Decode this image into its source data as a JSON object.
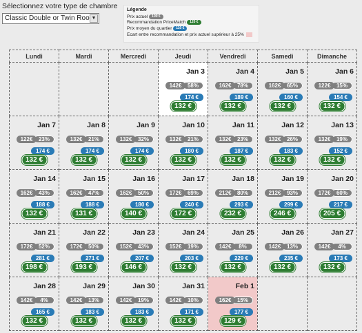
{
  "room": {
    "label": "Sélectionnez votre type de chambre",
    "selected": "Classic Double or Twin Room"
  },
  "legend": {
    "title": "Légende",
    "current_price_label": "Prix actuel",
    "current_price_sample": "100 €",
    "recommendation_label": "Recommandation PriceMatch",
    "recommendation_sample": "120 €",
    "avg_label": "Prix moyen du quartier",
    "avg_sample": "110 €",
    "gap_label": "Ecart entre recommandation et prix actuel supérieur à 25%"
  },
  "colors": {
    "current": "#808080",
    "average": "#2a7bb6",
    "recommendation": "#2e7d32",
    "alert": "#f2c9c9",
    "today": "#ffffff"
  },
  "calendar": {
    "weekdays": [
      "Lundi",
      "Mardi",
      "Mercredi",
      "Jeudi",
      "Vendredi",
      "Samedi",
      "Dimanche"
    ],
    "weeks": [
      [
        null,
        null,
        null,
        {
          "date": "Jan 3",
          "price": "142€",
          "pct": "58%",
          "avg": "174 €",
          "rec": "132 €",
          "today": true
        },
        {
          "date": "Jan 4",
          "price": "162€",
          "pct": "78%",
          "avg": "189 €",
          "rec": "132 €"
        },
        {
          "date": "Jan 5",
          "price": "162€",
          "pct": "65%",
          "avg": "160 €",
          "rec": "132 €"
        },
        {
          "date": "Jan 6",
          "price": "122€",
          "pct": "15%",
          "avg": "154 €",
          "rec": "132 €"
        }
      ],
      [
        {
          "date": "Jan 7",
          "price": "122€",
          "pct": "23%",
          "avg": "174 €",
          "rec": "132 €"
        },
        {
          "date": "Jan 8",
          "price": "132€",
          "pct": "21%",
          "avg": "174 €",
          "rec": "132 €"
        },
        {
          "date": "Jan 9",
          "price": "132€",
          "pct": "32%",
          "avg": "174 €",
          "rec": "132 €"
        },
        {
          "date": "Jan 10",
          "price": "132€",
          "pct": "21%",
          "avg": "180 €",
          "rec": "132 €"
        },
        {
          "date": "Jan 11",
          "price": "132€",
          "pct": "23%",
          "avg": "187 €",
          "rec": "132 €"
        },
        {
          "date": "Jan 12",
          "price": "132€",
          "pct": "26%",
          "avg": "183 €",
          "rec": "132 €"
        },
        {
          "date": "Jan 13",
          "price": "132€",
          "pct": "19%",
          "avg": "152 €",
          "rec": "132 €"
        }
      ],
      [
        {
          "date": "Jan 14",
          "price": "162€",
          "pct": "43%",
          "avg": "188 €",
          "rec": "132 €"
        },
        {
          "date": "Jan 15",
          "price": "162€",
          "pct": "47%",
          "avg": "188 €",
          "rec": "131 €"
        },
        {
          "date": "Jan 16",
          "price": "162€",
          "pct": "50%",
          "avg": "180 €",
          "rec": "140 €"
        },
        {
          "date": "Jan 17",
          "price": "172€",
          "pct": "69%",
          "avg": "240 €",
          "rec": "172 €"
        },
        {
          "date": "Jan 18",
          "price": "212€",
          "pct": "80%",
          "avg": "293 €",
          "rec": "232 €"
        },
        {
          "date": "Jan 19",
          "price": "212€",
          "pct": "93%",
          "avg": "299 €",
          "rec": "246 €"
        },
        {
          "date": "Jan 20",
          "price": "172€",
          "pct": "60%",
          "avg": "217 €",
          "rec": "205 €"
        }
      ],
      [
        {
          "date": "Jan 21",
          "price": "172€",
          "pct": "52%",
          "avg": "281 €",
          "rec": "198 €"
        },
        {
          "date": "Jan 22",
          "price": "172€",
          "pct": "50%",
          "avg": "271 €",
          "rec": "193 €"
        },
        {
          "date": "Jan 23",
          "price": "152€",
          "pct": "43%",
          "avg": "207 €",
          "rec": "146 €"
        },
        {
          "date": "Jan 24",
          "price": "152€",
          "pct": "19%",
          "avg": "203 €",
          "rec": "132 €"
        },
        {
          "date": "Jan 25",
          "price": "142€",
          "pct": "8%",
          "avg": "229 €",
          "rec": "132 €"
        },
        {
          "date": "Jan 26",
          "price": "142€",
          "pct": "13%",
          "avg": "235 €",
          "rec": "132 €"
        },
        {
          "date": "Jan 27",
          "price": "142€",
          "pct": "4%",
          "avg": "173 €",
          "rec": "132 €"
        }
      ],
      [
        {
          "date": "Jan 28",
          "price": "142€",
          "pct": "4%",
          "avg": "165 €",
          "rec": "132 €"
        },
        {
          "date": "Jan 29",
          "price": "142€",
          "pct": "13%",
          "avg": "183 €",
          "rec": "132 €"
        },
        {
          "date": "Jan 30",
          "price": "142€",
          "pct": "19%",
          "avg": "183 €",
          "rec": "132 €"
        },
        {
          "date": "Jan 31",
          "price": "142€",
          "pct": "10%",
          "avg": "171 €",
          "rec": "132 €"
        },
        {
          "date": "Feb 1",
          "price": "162€",
          "pct": "15%",
          "avg": "177 €",
          "rec": "129 €",
          "alert": true
        },
        null,
        null
      ]
    ]
  }
}
